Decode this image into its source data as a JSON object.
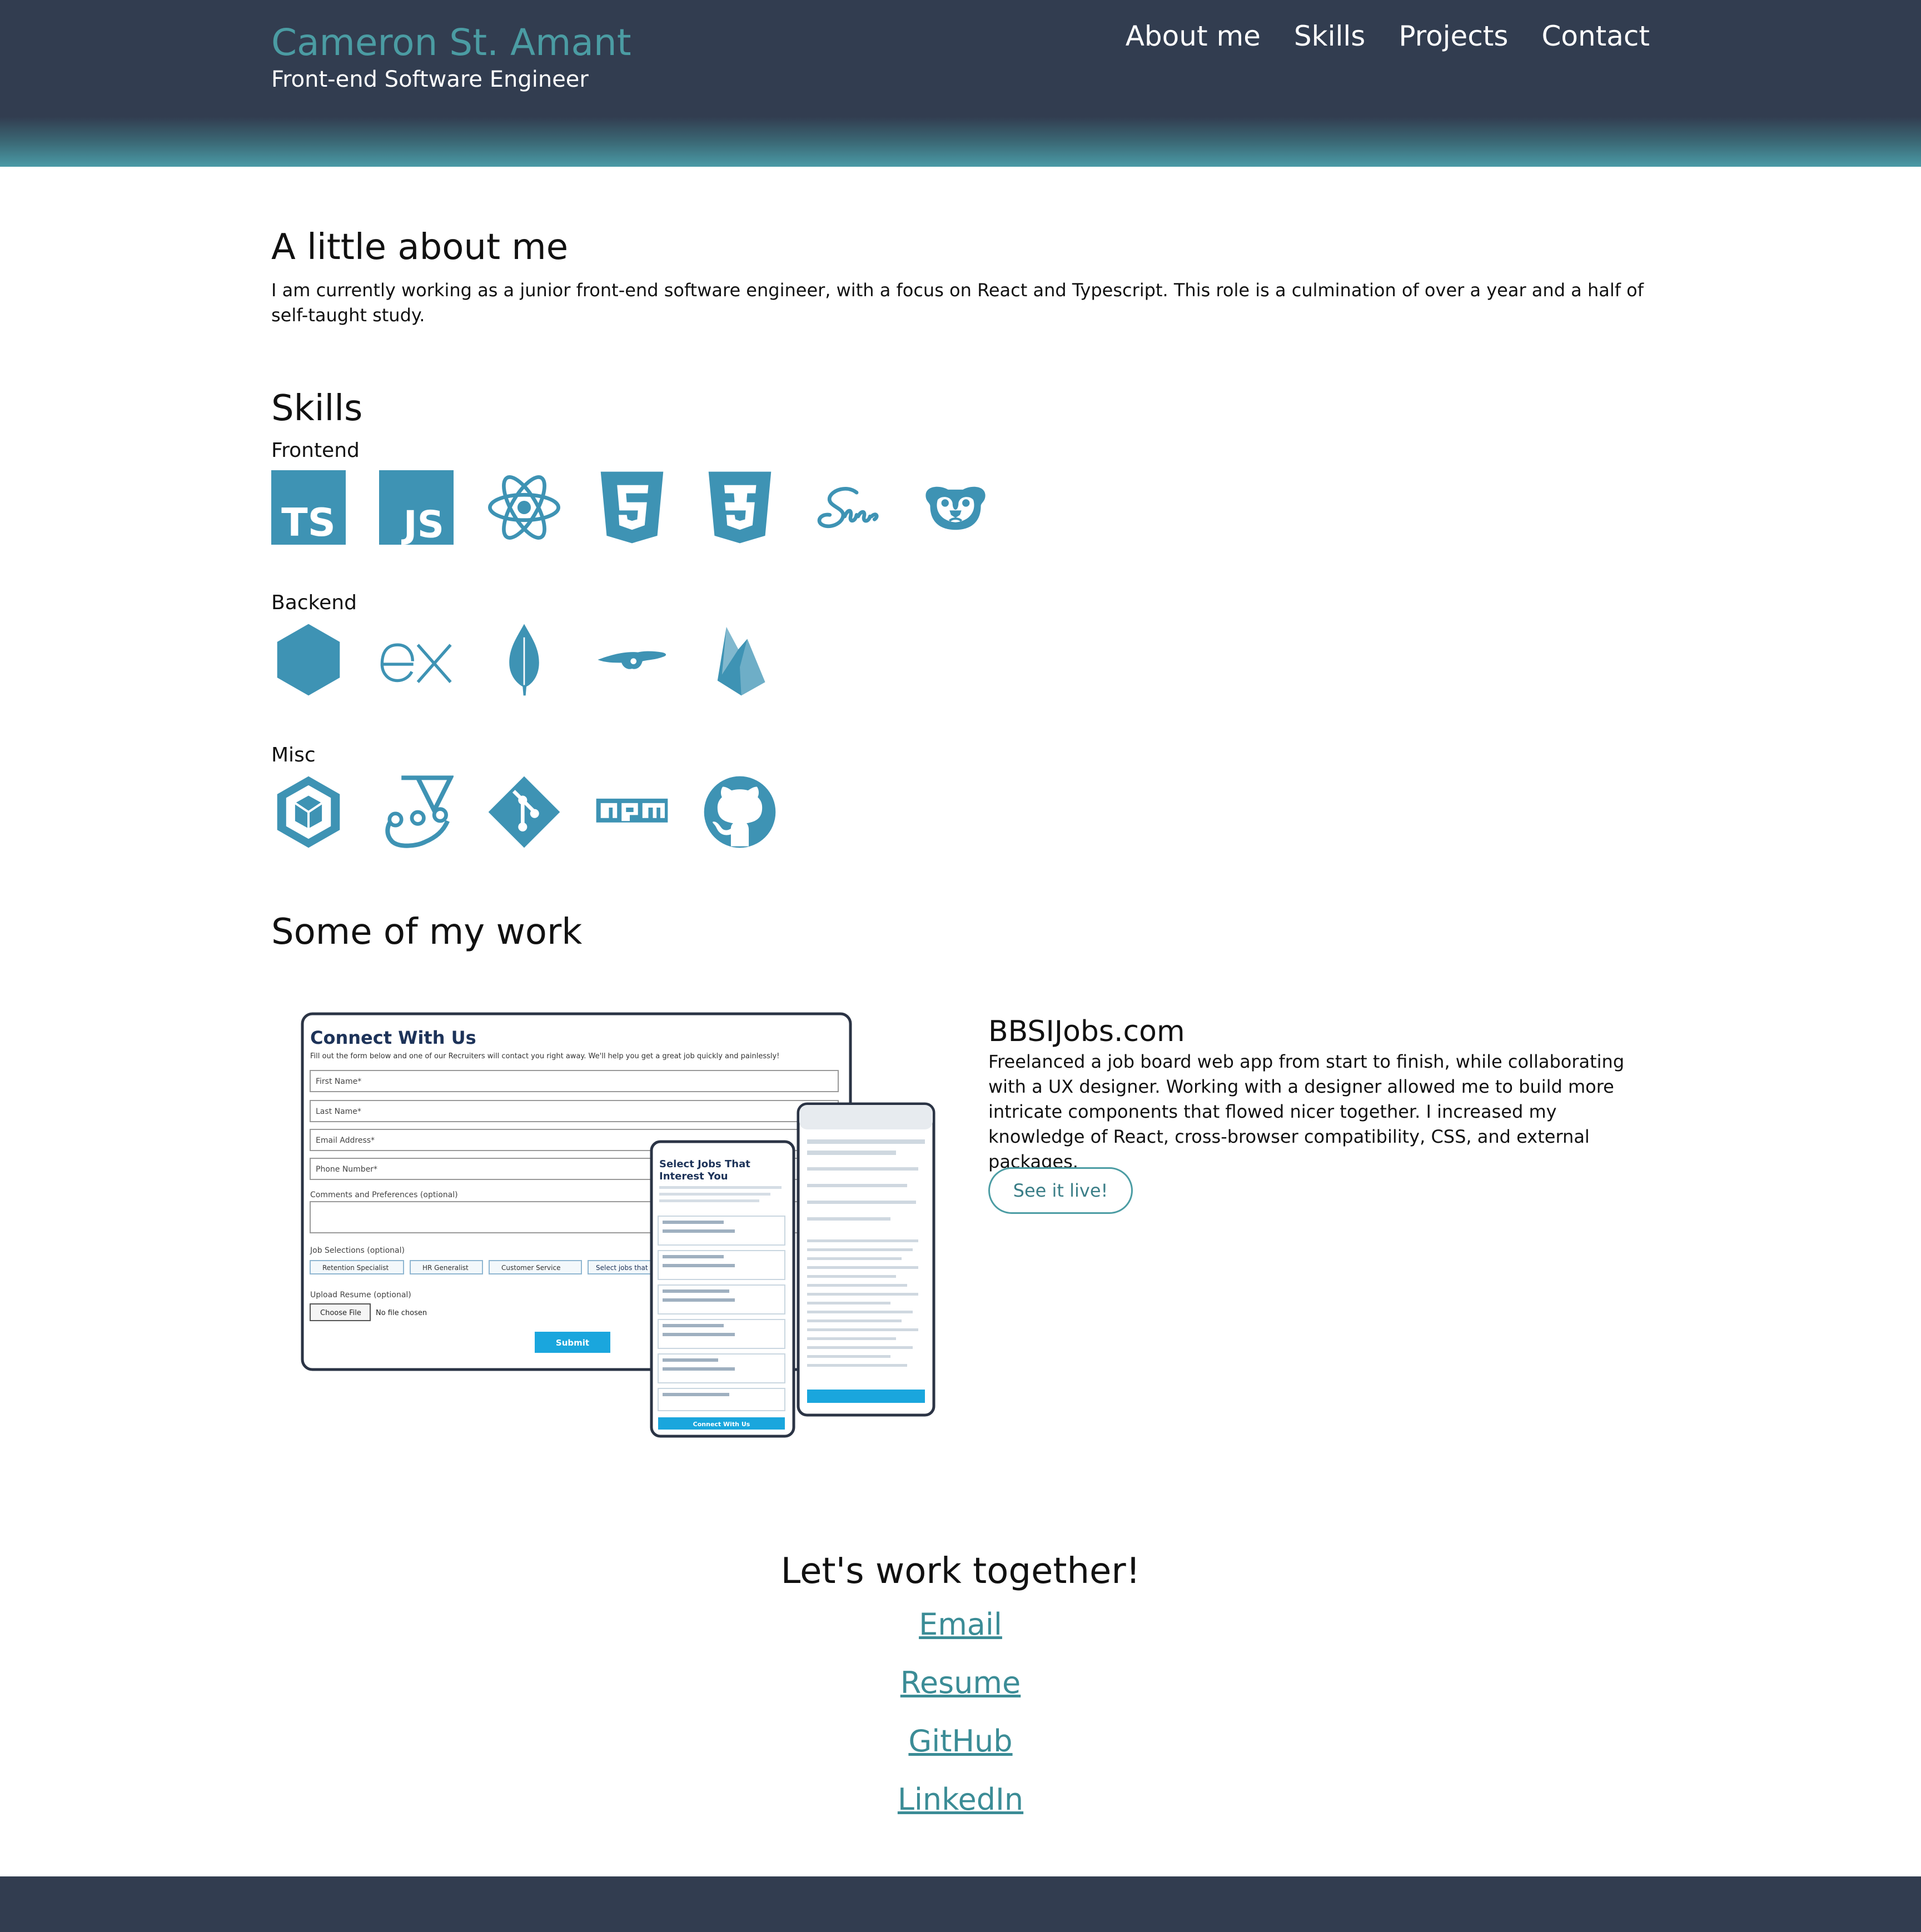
{
  "header": {
    "name": "Cameron St. Amant",
    "subtitle": "Front-end Software Engineer",
    "nav": [
      "About me",
      "Skills",
      "Projects",
      "Contact"
    ]
  },
  "about": {
    "heading": "A little about me",
    "text": "I am currently working as a junior front-end software engineer, with a focus on React and Typescript. This role is a culmination of over a year and a half of self-taught study."
  },
  "skills": {
    "heading": "Skills",
    "frontend_label": "Frontend",
    "frontend_icons": [
      "typescript-icon",
      "javascript-icon",
      "react-icon",
      "html5-icon",
      "css3-icon",
      "sass-icon",
      "pug-icon"
    ],
    "backend_label": "Backend",
    "backend_icons": [
      "nodejs-icon",
      "express-icon",
      "mongodb-icon",
      "mongoose-icon",
      "firebase-icon"
    ],
    "misc_label": "Misc",
    "misc_icons": [
      "webpack-icon",
      "jest-icon",
      "git-icon",
      "npm-icon",
      "github-icon"
    ],
    "icon_color": "#3e93b4"
  },
  "projects": {
    "heading": "Some of my work",
    "items": [
      {
        "title": "BBSIJobs.com",
        "description": "Freelanced a job board web app from start to finish, while collaborating with a UX designer. Working with a designer allowed me to build more intricate components that flowed nicer together. I increased my knowledge of React, cross-browser compatibility, CSS, and external packages.",
        "button": "See it live!",
        "screenshot": {
          "form_title": "Connect With Us",
          "form_intro": "Fill out the form below and one of our Recruiters will contact you right away. We'll help you get a great job quickly and painlessly!",
          "fields": [
            "First Name*",
            "Last Name*",
            "Email Address*",
            "Phone Number*"
          ],
          "comments_label": "Comments and Preferences (optional)",
          "job_label": "Job Selections (optional)",
          "chips": [
            "Retention Specialist",
            "HR Generalist",
            "Customer Service",
            "Select jobs that i"
          ],
          "upload_label": "Upload Resume (optional)",
          "choose_file": "Choose File",
          "no_file": "No file chosen",
          "submit": "Submit",
          "phone_title": "Select Jobs That Interest You",
          "phone_cta": "Connect With Us"
        }
      }
    ]
  },
  "contact": {
    "heading": "Let's work together!",
    "links": [
      "Email",
      "Resume",
      "GitHub",
      "LinkedIn"
    ]
  },
  "colors": {
    "header_bg": "#323d50",
    "accent": "#4b9ca3",
    "link": "#3b8c96"
  }
}
